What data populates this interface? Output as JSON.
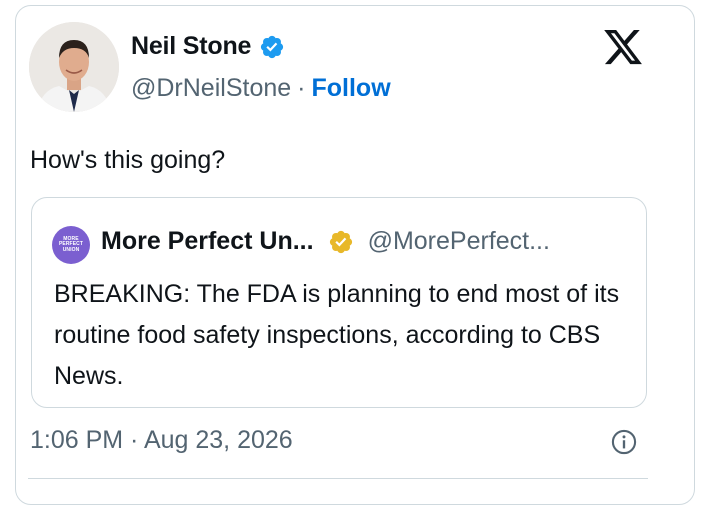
{
  "author": {
    "name": "Neil Stone",
    "handle": "@DrNeilStone",
    "separator": "·",
    "follow_label": "Follow",
    "verified_color": "#1d9bf0"
  },
  "tweet": {
    "text": "How's this going?",
    "timestamp": "1:06 PM · Aug 23, 2026"
  },
  "quote": {
    "avatar_lines": [
      "MORE",
      "PERFECT",
      "UNION"
    ],
    "name": "More Perfect Un...",
    "handle": "@MorePerfect...",
    "badge_color": "#e8b829",
    "body": "BREAKING: The FDA is planning to end most of its routine food safety inspections, according to CBS News."
  },
  "icons": {
    "brand": "x-logo-icon",
    "info": "info-icon"
  },
  "colors": {
    "link": "#006fd6",
    "muted": "#536471",
    "border": "#cfd9de"
  }
}
